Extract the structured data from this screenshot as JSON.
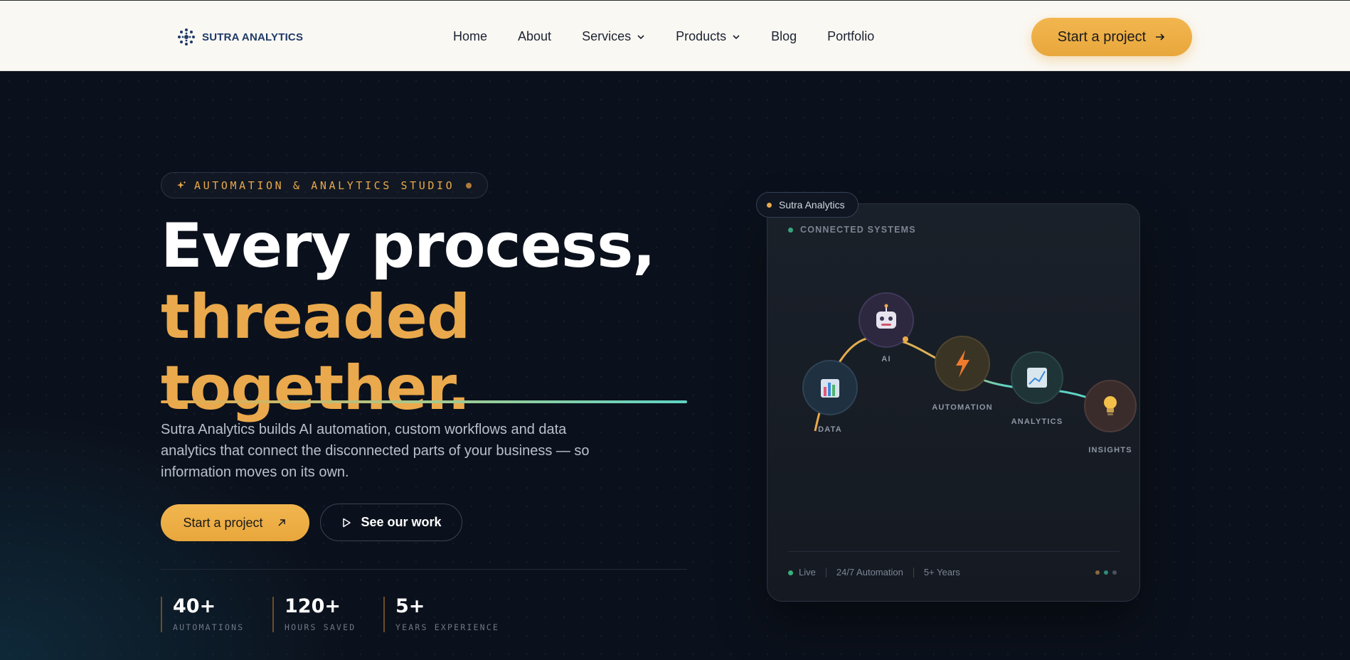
{
  "nav": {
    "brand": "SUTRA ANALYTICS",
    "links": [
      {
        "label": "Home"
      },
      {
        "label": "About"
      },
      {
        "label": "Services"
      },
      {
        "label": "Products"
      },
      {
        "label": "Blog"
      },
      {
        "label": "Portfolio"
      }
    ],
    "cta": "Start a project"
  },
  "hero": {
    "eyebrow": "AUTOMATION & ANALYTICS STUDIO",
    "headline_line1": "Every process,",
    "headline_line2": "threaded",
    "headline_line3": "together.",
    "lede": "Sutra Analytics builds AI automation, custom workflows and data analytics that connect the disconnected parts of your business — so information moves on its own.",
    "primary_cta": "Start a project",
    "secondary_cta": "See our work",
    "stats": [
      {
        "value": "40+",
        "label": "AUTOMATIONS"
      },
      {
        "value": "120+",
        "label": "HOURS SAVED"
      },
      {
        "value": "5+",
        "label": "YEARS EXPERIENCE"
      }
    ]
  },
  "card": {
    "chip": "Sutra Analytics",
    "title": "CONNECTED SYSTEMS",
    "nodes": [
      {
        "label": "DATA",
        "icon": "bar-chart-icon"
      },
      {
        "label": "AI",
        "icon": "robot-icon"
      },
      {
        "label": "AUTOMATION",
        "icon": "lightning-icon"
      },
      {
        "label": "ANALYTICS",
        "icon": "trend-chart-icon"
      },
      {
        "label": "INSIGHTS",
        "icon": "lightbulb-icon"
      }
    ],
    "footer": {
      "status": "Live",
      "item2": "24/7 Automation",
      "item3": "5+ Years"
    }
  },
  "colors": {
    "accent": "#eaa94c",
    "teal": "#5fd3c4",
    "background": "#0b111c",
    "nav_bg": "#faf8f3",
    "live": "#38b07e"
  }
}
